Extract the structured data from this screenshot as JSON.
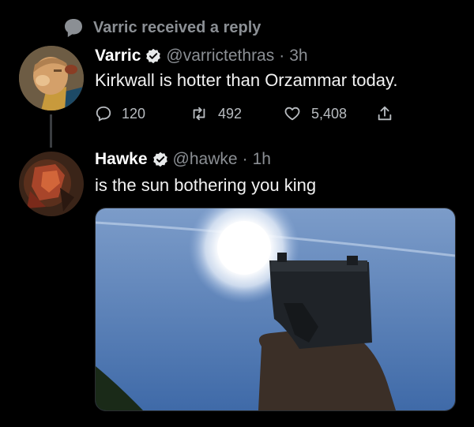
{
  "context": {
    "text": "Varric received a reply",
    "icon": "speech-bubble-icon"
  },
  "tweet1": {
    "name": "Varric",
    "handle": "@varrictethras",
    "separator": "·",
    "time": "3h",
    "text": "Kirkwall is hotter than Orzammar today.",
    "stats": {
      "replies": "120",
      "retweets": "492",
      "likes": "5,408"
    }
  },
  "tweet2": {
    "name": "Hawke",
    "handle": "@hawke",
    "separator": "·",
    "time": "1h",
    "text": "is the sun bothering you king"
  },
  "colors": {
    "background": "#000000",
    "muted": "#8b8f94",
    "verified": "#e7e9ea"
  }
}
